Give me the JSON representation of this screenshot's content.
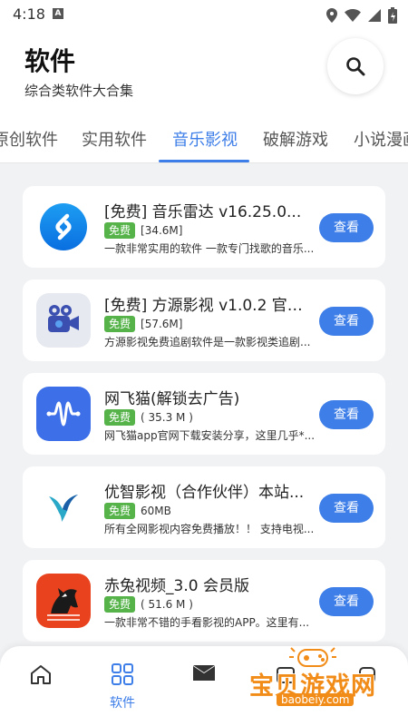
{
  "status_bar": {
    "time": "4:18",
    "notification_letter": "A"
  },
  "header": {
    "title": "软件",
    "subtitle": "综合类软件大合集"
  },
  "tabs": [
    {
      "label": "原创软件"
    },
    {
      "label": "实用软件"
    },
    {
      "label": "音乐影视",
      "active": true
    },
    {
      "label": "破解游戏"
    },
    {
      "label": "小说漫画"
    }
  ],
  "apps": [
    {
      "title": "[免费] 音乐雷达  v16.25.0...",
      "badge": "免费",
      "size": "[34.6M]",
      "desc": "一款非常实用的软件 一款专门找歌的音乐...",
      "button": "查看",
      "icon": "shazam-icon"
    },
    {
      "title": "[免费] 方源影视 v1.0.2 官方...",
      "badge": "免费",
      "size": "[57.6M]",
      "desc": "方源影视免费追剧软件是一款影视类追剧...",
      "button": "查看",
      "icon": "film-camera-icon"
    },
    {
      "title": "网飞猫(解锁去广告)",
      "badge": "免费",
      "size": "( 35.3 M )",
      "desc": "网飞猫app官网下载安装分享，这里几乎*...",
      "button": "查看",
      "icon": "wave-icon"
    },
    {
      "title": "优智影视（合作伙伴）本站...",
      "badge": "免费",
      "size": "60MB",
      "desc": "所有全网影视内容免费播放！！ 支持电视...",
      "button": "查看",
      "icon": "bird-icon"
    },
    {
      "title": "赤兔视频_3.0 会员版",
      "badge": "免费",
      "size": "( 51.6 M )",
      "desc": "一款非常不错的手看影视的APP。这里有...",
      "button": "查看",
      "icon": "horse-icon"
    }
  ],
  "bottom_nav": {
    "active_label": "软件"
  },
  "watermark": {
    "text": "宝贝游戏网",
    "url": "baobeiy.com"
  },
  "colors": {
    "accent": "#3d7ee8",
    "badge": "#55b34a",
    "watermark": "#f28c18"
  }
}
